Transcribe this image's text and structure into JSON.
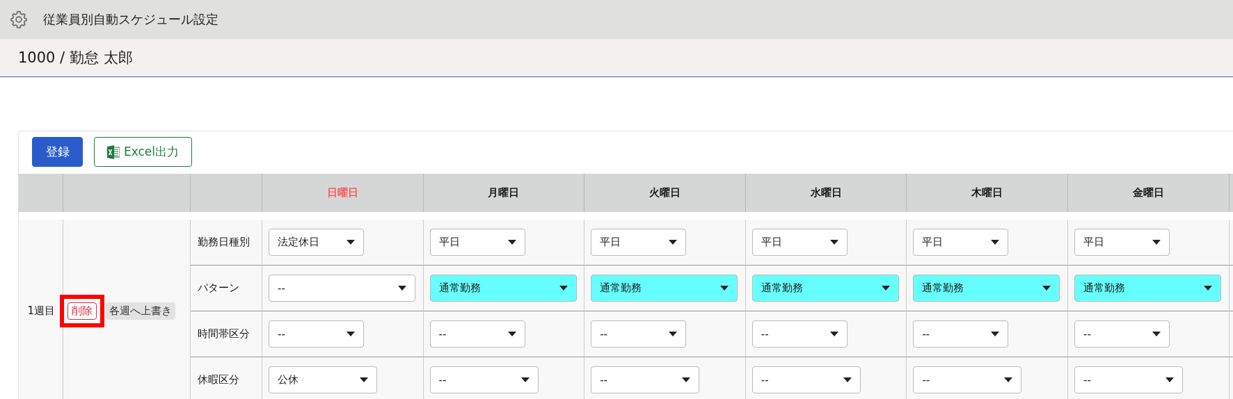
{
  "header": {
    "title": "従業員別自動スケジュール設定"
  },
  "employee": {
    "label": "1000 / 勤怠 太郎"
  },
  "toolbar": {
    "buttons": [
      {
        "kind": "primary",
        "label": "登録"
      },
      {
        "kind": "excel",
        "label": "Excel出力"
      }
    ]
  },
  "schedule": {
    "days": [
      {
        "label": "日曜日",
        "color": "#ff5a5a"
      },
      {
        "label": "月曜日",
        "color": "#1a1a1a"
      },
      {
        "label": "火曜日",
        "color": "#1a1a1a"
      },
      {
        "label": "水曜日",
        "color": "#1a1a1a"
      },
      {
        "label": "木曜日",
        "color": "#1a1a1a"
      },
      {
        "label": "金曜日",
        "color": "#1a1a1a"
      }
    ],
    "weeks": [
      {
        "label": "1週目",
        "delete_button": {
          "label": "削除",
          "annotated": true
        },
        "copy_button": {
          "label": "各週へ上書き"
        },
        "rows": [
          {
            "label": "勤務日種別",
            "cells": [
              {
                "value": "法定休日"
              },
              {
                "value": "平日"
              },
              {
                "value": "平日"
              },
              {
                "value": "平日"
              },
              {
                "value": "平日"
              },
              {
                "value": "平日"
              }
            ]
          },
          {
            "label": "パターン",
            "cells": [
              {
                "value": "--",
                "highlighted": false
              },
              {
                "value": "通常勤務",
                "highlighted": true
              },
              {
                "value": "通常勤務",
                "highlighted": true
              },
              {
                "value": "通常勤務",
                "highlighted": true
              },
              {
                "value": "通常勤務",
                "highlighted": true
              },
              {
                "value": "通常勤務",
                "highlighted": true
              }
            ]
          },
          {
            "label": "時間帯区分",
            "cells": [
              {
                "value": "--"
              },
              {
                "value": "--"
              },
              {
                "value": "--"
              },
              {
                "value": "--"
              },
              {
                "value": "--"
              },
              {
                "value": "--"
              }
            ]
          },
          {
            "label": "休暇区分",
            "cells": [
              {
                "value": "公休"
              },
              {
                "value": "--"
              },
              {
                "value": "--"
              },
              {
                "value": "--"
              },
              {
                "value": "--"
              },
              {
                "value": "--"
              }
            ]
          }
        ]
      }
    ]
  }
}
